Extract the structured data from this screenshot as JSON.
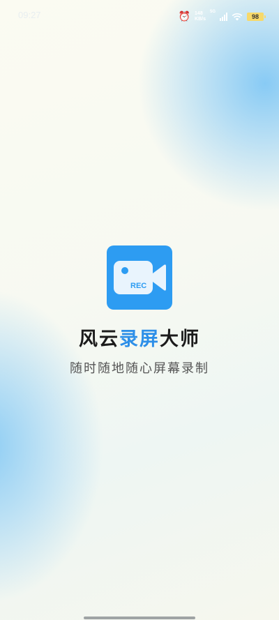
{
  "status_bar": {
    "time": "09:27",
    "speed_value": "148",
    "speed_unit": "KB/s",
    "network": "5G",
    "battery": "98",
    "alarm_icon": "alarm-clock-icon",
    "signal_icon": "signal-bars-icon",
    "wifi_icon": "wifi-icon"
  },
  "app": {
    "logo_icon": "video-camera-rec-icon",
    "logo_text": "REC",
    "title_part1": "风云",
    "title_part2": "录屏",
    "title_part3": "大师",
    "subtitle": "随时随地随心屏幕录制"
  },
  "colors": {
    "accent": "#2d8fe8",
    "logo_bg": "#2d9cf2"
  }
}
